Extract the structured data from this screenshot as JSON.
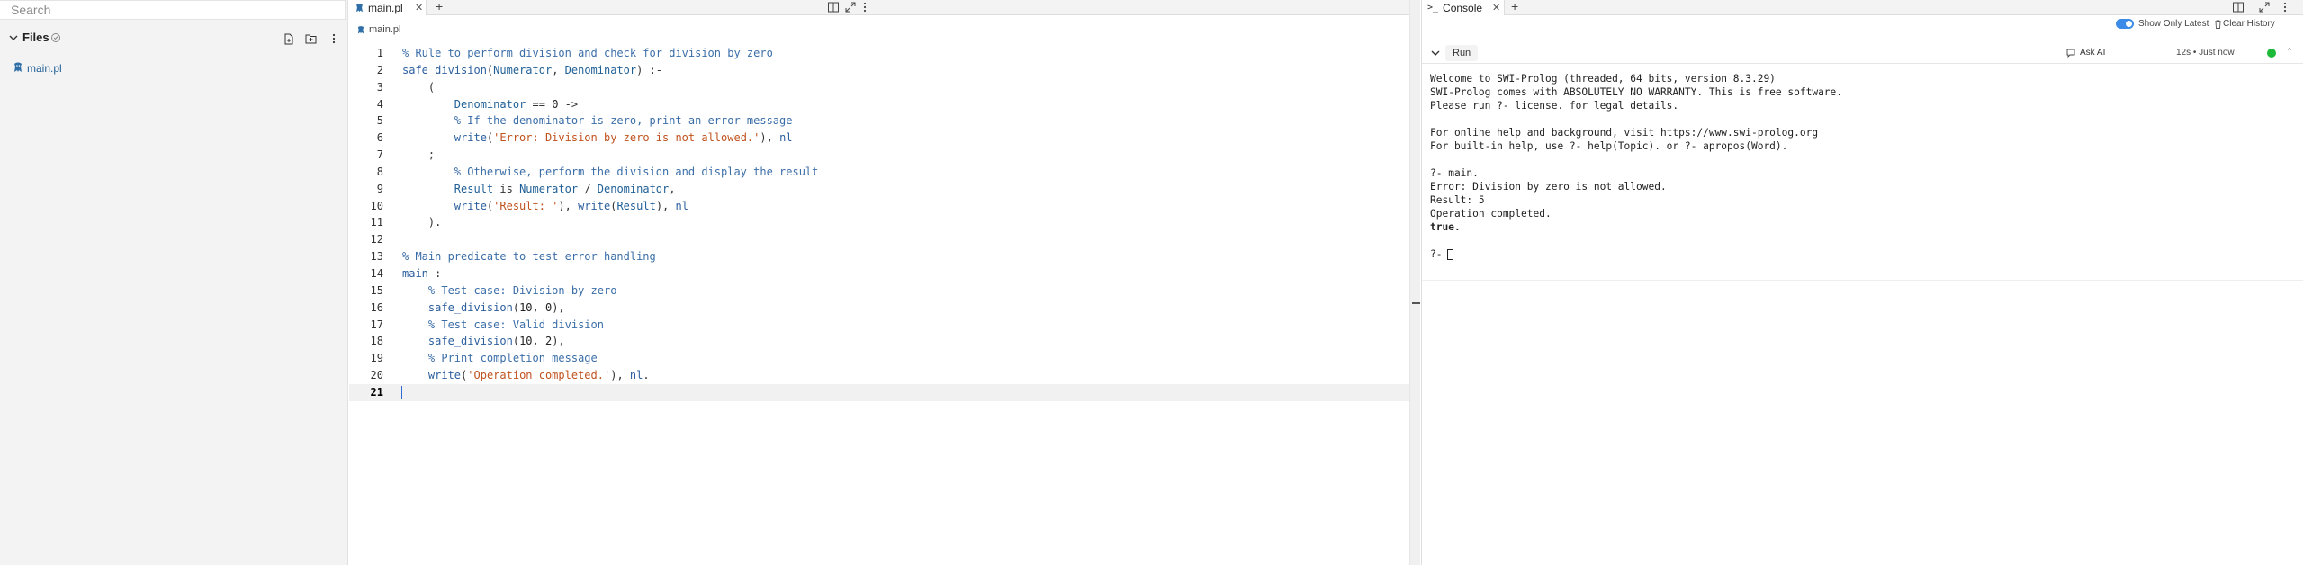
{
  "sidebar": {
    "search_placeholder": "Search",
    "files_title": "Files",
    "files": [
      {
        "name": "main.pl"
      }
    ]
  },
  "editor": {
    "tab_label": "main.pl",
    "breadcrumb": "main.pl",
    "active_line": 21,
    "lines": [
      {
        "n": "1",
        "tokens": [
          [
            "c",
            "% Rule to perform division and check for division by zero"
          ]
        ]
      },
      {
        "n": "2",
        "tokens": [
          [
            "f",
            "safe_division"
          ],
          [
            "o",
            "("
          ],
          [
            "v",
            "Numerator"
          ],
          [
            "o",
            ", "
          ],
          [
            "v",
            "Denominator"
          ],
          [
            "o",
            ") :-"
          ]
        ]
      },
      {
        "n": "3",
        "tokens": [
          [
            "o",
            "    ("
          ]
        ]
      },
      {
        "n": "4",
        "tokens": [
          [
            "o",
            "        "
          ],
          [
            "v",
            "Denominator"
          ],
          [
            "o",
            " == "
          ],
          [
            "n",
            "0"
          ],
          [
            "o",
            " ->"
          ]
        ]
      },
      {
        "n": "5",
        "tokens": [
          [
            "o",
            "        "
          ],
          [
            "c",
            "% If the denominator is zero, print an error message"
          ]
        ]
      },
      {
        "n": "6",
        "tokens": [
          [
            "o",
            "        "
          ],
          [
            "f",
            "write"
          ],
          [
            "o",
            "("
          ],
          [
            "s",
            "'Error: Division by zero is not allowed.'"
          ],
          [
            "o",
            "), "
          ],
          [
            "f",
            "nl"
          ]
        ]
      },
      {
        "n": "7",
        "tokens": [
          [
            "o",
            "    ;"
          ]
        ]
      },
      {
        "n": "8",
        "tokens": [
          [
            "o",
            "        "
          ],
          [
            "c",
            "% Otherwise, perform the division and display the result"
          ]
        ]
      },
      {
        "n": "9",
        "tokens": [
          [
            "o",
            "        "
          ],
          [
            "v",
            "Result"
          ],
          [
            "o",
            " is "
          ],
          [
            "v",
            "Numerator"
          ],
          [
            "o",
            " / "
          ],
          [
            "v",
            "Denominator"
          ],
          [
            "o",
            ","
          ]
        ]
      },
      {
        "n": "10",
        "tokens": [
          [
            "o",
            "        "
          ],
          [
            "f",
            "write"
          ],
          [
            "o",
            "("
          ],
          [
            "s",
            "'Result: '"
          ],
          [
            "o",
            "), "
          ],
          [
            "f",
            "write"
          ],
          [
            "o",
            "("
          ],
          [
            "v",
            "Result"
          ],
          [
            "o",
            "), "
          ],
          [
            "f",
            "nl"
          ]
        ]
      },
      {
        "n": "11",
        "tokens": [
          [
            "o",
            "    )."
          ]
        ]
      },
      {
        "n": "12",
        "tokens": []
      },
      {
        "n": "13",
        "tokens": [
          [
            "c",
            "% Main predicate to test error handling"
          ]
        ]
      },
      {
        "n": "14",
        "tokens": [
          [
            "f",
            "main"
          ],
          [
            "o",
            " :-"
          ]
        ]
      },
      {
        "n": "15",
        "tokens": [
          [
            "o",
            "    "
          ],
          [
            "c",
            "% Test case: Division by zero"
          ]
        ]
      },
      {
        "n": "16",
        "tokens": [
          [
            "o",
            "    "
          ],
          [
            "f",
            "safe_division"
          ],
          [
            "o",
            "("
          ],
          [
            "n",
            "10"
          ],
          [
            "o",
            ", "
          ],
          [
            "n",
            "0"
          ],
          [
            "o",
            "),"
          ]
        ]
      },
      {
        "n": "17",
        "tokens": [
          [
            "o",
            "    "
          ],
          [
            "c",
            "% Test case: Valid division"
          ]
        ]
      },
      {
        "n": "18",
        "tokens": [
          [
            "o",
            "    "
          ],
          [
            "f",
            "safe_division"
          ],
          [
            "o",
            "("
          ],
          [
            "n",
            "10"
          ],
          [
            "o",
            ", "
          ],
          [
            "n",
            "2"
          ],
          [
            "o",
            "),"
          ]
        ]
      },
      {
        "n": "19",
        "tokens": [
          [
            "o",
            "    "
          ],
          [
            "c",
            "% Print completion message"
          ]
        ]
      },
      {
        "n": "20",
        "tokens": [
          [
            "o",
            "    "
          ],
          [
            "f",
            "write"
          ],
          [
            "o",
            "("
          ],
          [
            "s",
            "'Operation completed.'"
          ],
          [
            "o",
            "), "
          ],
          [
            "f",
            "nl"
          ],
          [
            "o",
            "."
          ]
        ]
      },
      {
        "n": "21",
        "tokens": []
      }
    ]
  },
  "console": {
    "tab_label": "Console",
    "show_only_latest_label": "Show Only Latest",
    "show_only_latest": true,
    "clear_history_label": "Clear History",
    "run_label": "Run",
    "ask_ai_label": "Ask AI",
    "timing": "12s • Just now",
    "status_color": "#1db938",
    "output": [
      {
        "text": "Welcome to SWI-Prolog (threaded, 64 bits, version 8.3.29)",
        "bold": false
      },
      {
        "text": "SWI-Prolog comes with ABSOLUTELY NO WARRANTY. This is free software.",
        "bold": false
      },
      {
        "text": "Please run ?- license. for legal details.",
        "bold": false
      },
      {
        "text": "",
        "bold": false
      },
      {
        "text": "For online help and background, visit https://www.swi-prolog.org",
        "bold": false
      },
      {
        "text": "For built-in help, use ?- help(Topic). or ?- apropos(Word).",
        "bold": false
      },
      {
        "text": "",
        "bold": false
      },
      {
        "text": "?- main.",
        "bold": false
      },
      {
        "text": "Error: Division by zero is not allowed.",
        "bold": false
      },
      {
        "text": "Result: 5",
        "bold": false
      },
      {
        "text": "Operation completed.",
        "bold": false
      },
      {
        "text": "true.",
        "bold": true
      },
      {
        "text": "",
        "bold": false
      }
    ],
    "prompt": "?-"
  },
  "colors": {
    "comment": "#3b6ea8",
    "string": "#c0521e",
    "variable": "#1f5f96",
    "accent": "#3d8be8"
  }
}
